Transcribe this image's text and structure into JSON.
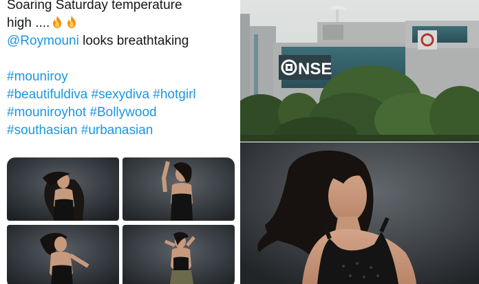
{
  "tweet": {
    "line1": "Soaring Saturday temperature",
    "line2": "high ....",
    "emoji_fire": "🔥🔥",
    "mention": "@Roymouni",
    "mention_rest": " looks breathtaking",
    "hashtags": [
      "#mouniroy",
      "#beautifuldiva #sexydiva #hotgirl",
      "#mouniroyhot #Bollywood",
      "#southasian #urbanasian"
    ],
    "link_color": "#1b95e0"
  },
  "nse_photo": {
    "building_sign": "NSE"
  },
  "icons": [
    "fire-icon",
    "nse-logo-icon"
  ]
}
